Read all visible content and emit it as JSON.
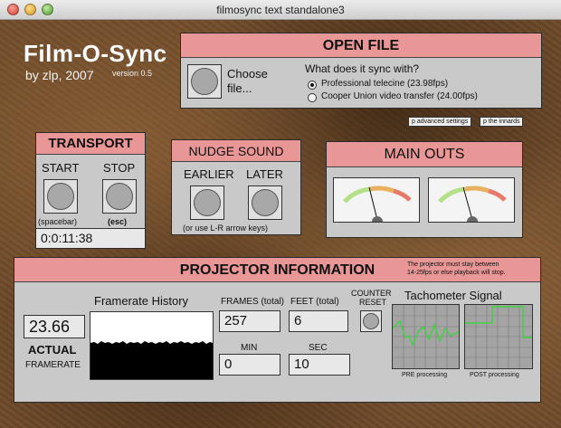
{
  "window": {
    "title": "filmosync text standalone3"
  },
  "app": {
    "title": "Film-O-Sync",
    "byline": "by zlp, 2007",
    "version": "version 0.5"
  },
  "open_file": {
    "header": "OPEN FILE",
    "choose_label_line1": "Choose",
    "choose_label_line2": "file...",
    "question": "What does it sync with?",
    "options": [
      {
        "label": "Professional telecine (23.98fps)",
        "selected": true
      },
      {
        "label": "Cooper Union video transfer (24.00fps)",
        "selected": false
      }
    ]
  },
  "small_buttons": {
    "advanced": "p advanced settings",
    "innards": "p the innards"
  },
  "transport": {
    "header": "TRANSPORT",
    "start_label": "START",
    "stop_label": "STOP",
    "start_hint": "(spacebar)",
    "stop_hint": "(esc)",
    "timecode": "0:0:11:38"
  },
  "nudge": {
    "header": "NUDGE SOUND",
    "earlier_label": "EARLIER",
    "later_label": "LATER",
    "hint": "(or use L-R arrow keys)"
  },
  "main_outs": {
    "header": "MAIN OUTS"
  },
  "projector": {
    "header": "PROJECTOR INFORMATION",
    "note_line1": "The projector must stay between",
    "note_line2": "14-25fps or else playback will stop.",
    "framerate_value": "23.66",
    "actual_label": "ACTUAL",
    "framerate_label": "FRAMERATE",
    "history_title": "Framerate History",
    "frames_label": "FRAMES (total)",
    "frames_value": "257",
    "feet_label": "FEET (total)",
    "feet_value": "6",
    "counter_label_line1": "COUNTER",
    "counter_label_line2": "RESET",
    "min_label": "MIN",
    "min_value": "0",
    "sec_label": "SEC",
    "sec_value": "10",
    "tacho_title": "Tachometer Signal",
    "pre_label": "PRE processing",
    "post_label": "POST processing"
  },
  "colors": {
    "panel_header": "#e89696",
    "panel_body": "#c9c9c9",
    "signal_green": "#3fd23f"
  }
}
